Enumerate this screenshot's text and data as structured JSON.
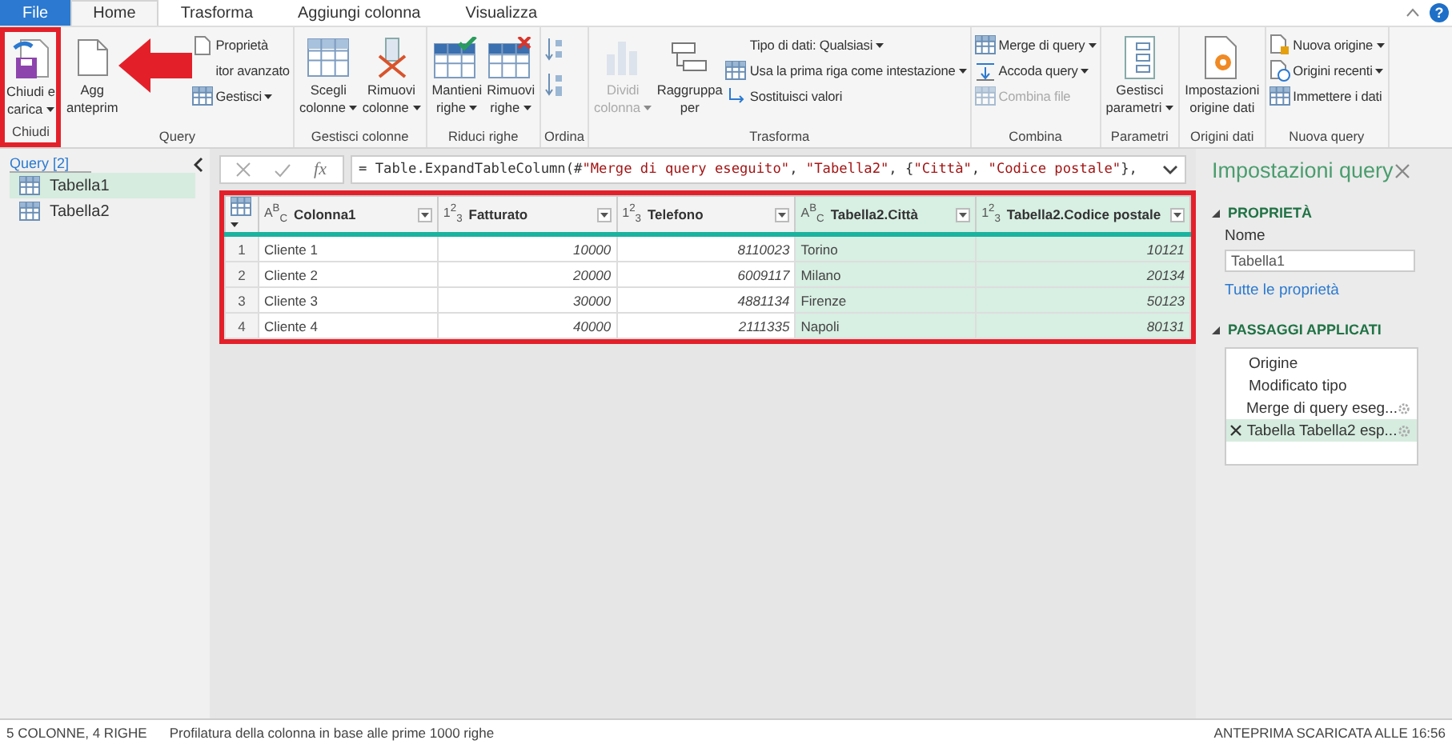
{
  "tabs": [
    {
      "label": "File",
      "kind": "file",
      "selected": false
    },
    {
      "label": "Home",
      "kind": "tab",
      "selected": true
    },
    {
      "label": "Trasforma",
      "kind": "tab",
      "selected": false
    },
    {
      "label": "Aggiungi colonna",
      "kind": "tab",
      "selected": false
    },
    {
      "label": "Visualizza",
      "kind": "tab",
      "selected": false
    }
  ],
  "help": "?",
  "ribbon": [
    {
      "label": "Chiudi",
      "annotated": true,
      "items": [
        {
          "kind": "large",
          "lines": [
            "Chiudi e",
            "carica"
          ],
          "dropdown": true,
          "disabled": false
        }
      ]
    },
    {
      "label": "Query",
      "items": [
        {
          "kind": "large",
          "lines": [
            "Agg",
            "anteprim"
          ],
          "dropdown": false,
          "disabled": false
        },
        {
          "kind": "small",
          "text": "Proprietà",
          "dropdown": false,
          "disabled": false
        },
        {
          "kind": "small",
          "text": "itor avanzato",
          "dropdown": false,
          "disabled": false
        },
        {
          "kind": "small",
          "text": "Gestisci",
          "dropdown": true,
          "disabled": false
        }
      ]
    },
    {
      "label": "Gestisci colonne",
      "items": [
        {
          "kind": "large",
          "lines": [
            "Scegli",
            "colonne"
          ],
          "dropdown": true,
          "disabled": false
        },
        {
          "kind": "large",
          "lines": [
            "Rimuovi",
            "colonne"
          ],
          "dropdown": true,
          "disabled": false
        }
      ]
    },
    {
      "label": "Riduci righe",
      "items": [
        {
          "kind": "large",
          "lines": [
            "Mantieni",
            "righe"
          ],
          "dropdown": true,
          "disabled": false
        },
        {
          "kind": "large",
          "lines": [
            "Rimuovi",
            "righe"
          ],
          "dropdown": true,
          "disabled": false
        }
      ]
    },
    {
      "label": "Ordina",
      "items": [
        {
          "kind": "icon",
          "disabled": false
        },
        {
          "kind": "icon",
          "disabled": false
        }
      ]
    },
    {
      "label": "Trasforma",
      "items": [
        {
          "kind": "large",
          "lines": [
            "Dividi",
            "colonna"
          ],
          "dropdown": true,
          "disabled": true
        },
        {
          "kind": "large",
          "lines": [
            "Raggruppa",
            "per"
          ],
          "dropdown": false,
          "disabled": false
        },
        {
          "kind": "small",
          "text": "Tipo di dati: Qualsiasi",
          "dropdown": true,
          "disabled": false
        },
        {
          "kind": "small",
          "text": "Usa la prima riga come intestazione",
          "dropdown": true,
          "disabled": false
        },
        {
          "kind": "small",
          "text": "Sostituisci valori",
          "dropdown": false,
          "disabled": false
        }
      ]
    },
    {
      "label": "Combina",
      "items": [
        {
          "kind": "small",
          "text": "Merge di query",
          "dropdown": true,
          "disabled": false
        },
        {
          "kind": "small",
          "text": "Accoda query",
          "dropdown": true,
          "disabled": false
        },
        {
          "kind": "small",
          "text": "Combina file",
          "dropdown": false,
          "disabled": true
        }
      ]
    },
    {
      "label": "Parametri",
      "items": [
        {
          "kind": "large",
          "lines": [
            "Gestisci",
            "parametri"
          ],
          "dropdown": true,
          "disabled": false
        }
      ]
    },
    {
      "label": "Origini dati",
      "items": [
        {
          "kind": "large",
          "lines": [
            "Impostazioni",
            "origine dati"
          ],
          "dropdown": false,
          "disabled": false
        }
      ]
    },
    {
      "label": "Nuova query",
      "items": [
        {
          "kind": "small",
          "text": "Nuova origine",
          "dropdown": true,
          "disabled": false
        },
        {
          "kind": "small",
          "text": "Origini recenti",
          "dropdown": true,
          "disabled": false
        },
        {
          "kind": "small",
          "text": "Immettere i dati",
          "dropdown": false,
          "disabled": false
        }
      ]
    }
  ],
  "queries": {
    "title": "Query [2]",
    "items": [
      {
        "label": "Tabella1",
        "selected": true
      },
      {
        "label": "Tabella2",
        "selected": false
      }
    ]
  },
  "formula_bar": {
    "fx": "fx",
    "parts": [
      {
        "kind": "code",
        "text": "= Table.ExpandTableColumn(#"
      },
      {
        "kind": "string",
        "text": "\"Merge di query eseguito\""
      },
      {
        "kind": "code",
        "text": ", "
      },
      {
        "kind": "string",
        "text": "\"Tabella2\""
      },
      {
        "kind": "code",
        "text": ", {"
      },
      {
        "kind": "string",
        "text": "\"Città\""
      },
      {
        "kind": "code",
        "text": ", "
      },
      {
        "kind": "string",
        "text": "\"Codice postale\""
      },
      {
        "kind": "code",
        "text": "},"
      }
    ]
  },
  "table": {
    "annotated": true,
    "columns": [
      {
        "type_label": "A$^{B}$$_{C}$",
        "name": "Colonna1",
        "kind": "text",
        "highlighted": false
      },
      {
        "type_label": "1$^{2}$$_{3}$",
        "name": "Fatturato",
        "kind": "number",
        "highlighted": false
      },
      {
        "type_label": "1$^{2}$$_{3}$",
        "name": "Telefono",
        "kind": "number",
        "highlighted": false
      },
      {
        "type_label": "A$^{B}$$_{C}$",
        "name": "Tabella2.Città",
        "kind": "text",
        "highlighted": true
      },
      {
        "type_label": "1$^{2}$$_{3}$",
        "name": "Tabella2.Codice postale",
        "kind": "number",
        "highlighted": true
      }
    ],
    "rows": [
      {
        "number": "1",
        "cells": [
          "Cliente 1",
          "10000",
          "8110023",
          "Torino",
          "10121"
        ]
      },
      {
        "number": "2",
        "cells": [
          "Cliente 2",
          "20000",
          "6009117",
          "Milano",
          "20134"
        ]
      },
      {
        "number": "3",
        "cells": [
          "Cliente 3",
          "30000",
          "4881134",
          "Firenze",
          "50123"
        ]
      },
      {
        "number": "4",
        "cells": [
          "Cliente 4",
          "40000",
          "2111335",
          "Napoli",
          "80131"
        ]
      }
    ]
  },
  "settings": {
    "title": "Impostazioni query",
    "properties_heading": "PROPRIETÀ",
    "name_label": "Nome",
    "name_value": "Tabella1",
    "all_properties": "Tutte le proprietà",
    "steps_heading": "PASSAGGI APPLICATI",
    "steps": [
      {
        "label": "Origine",
        "selected": false,
        "has_settings": false
      },
      {
        "label": "Modificato tipo",
        "selected": false,
        "has_settings": false
      },
      {
        "label": "Merge di query eseg...",
        "selected": false,
        "has_settings": true
      },
      {
        "label": "Tabella Tabella2 esp...",
        "selected": true,
        "has_settings": true
      }
    ]
  },
  "status_bar": {
    "summary": "5 COLONNE, 4 RIGHE",
    "profiling": "Profilatura della colonna in base alle prime 1000 righe",
    "preview": "ANTEPRIMA SCARICATA ALLE 16:56"
  }
}
